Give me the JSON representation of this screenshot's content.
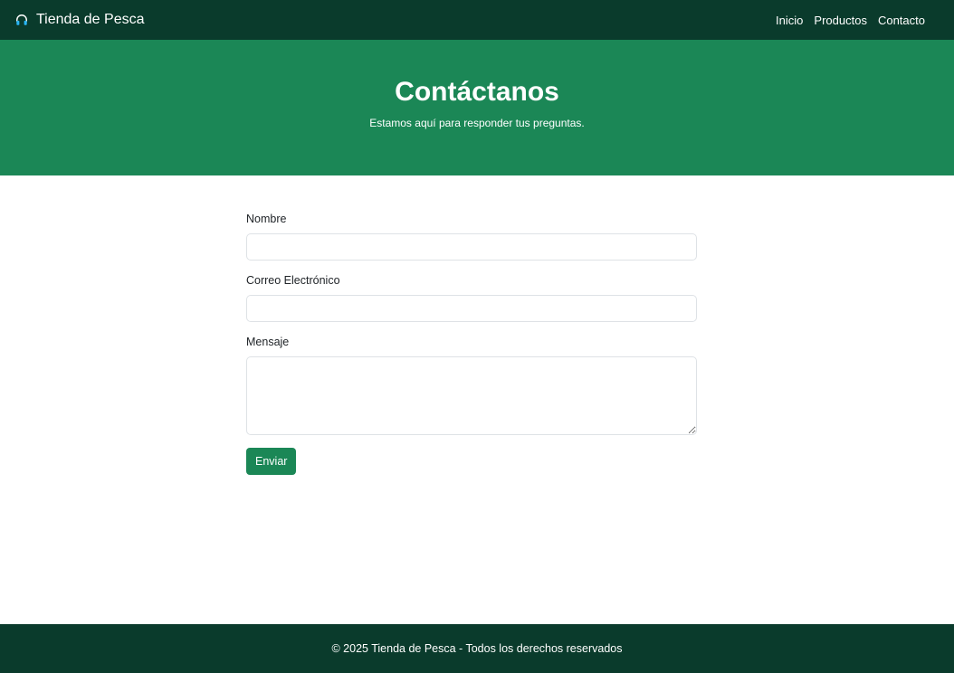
{
  "navbar": {
    "brand_icon": "headphones-icon",
    "brand": "Tienda de Pesca",
    "links": [
      "Inicio",
      "Productos",
      "Contacto"
    ]
  },
  "hero": {
    "title": "Contáctanos",
    "subtitle": "Estamos aquí para responder tus preguntas."
  },
  "form": {
    "name_label": "Nombre",
    "name_value": "",
    "email_label": "Correo Electrónico",
    "email_value": "",
    "message_label": "Mensaje",
    "message_value": "",
    "submit_label": "Enviar"
  },
  "footer": {
    "text": "© 2025 Tienda de Pesca - Todos los derechos reservados"
  },
  "colors": {
    "navbar_bg": "#0a3b2c",
    "hero_bg": "#1b8756",
    "button_bg": "#1b8756",
    "footer_bg": "#0a3b2c",
    "icon_accent": "#29b6f6"
  }
}
